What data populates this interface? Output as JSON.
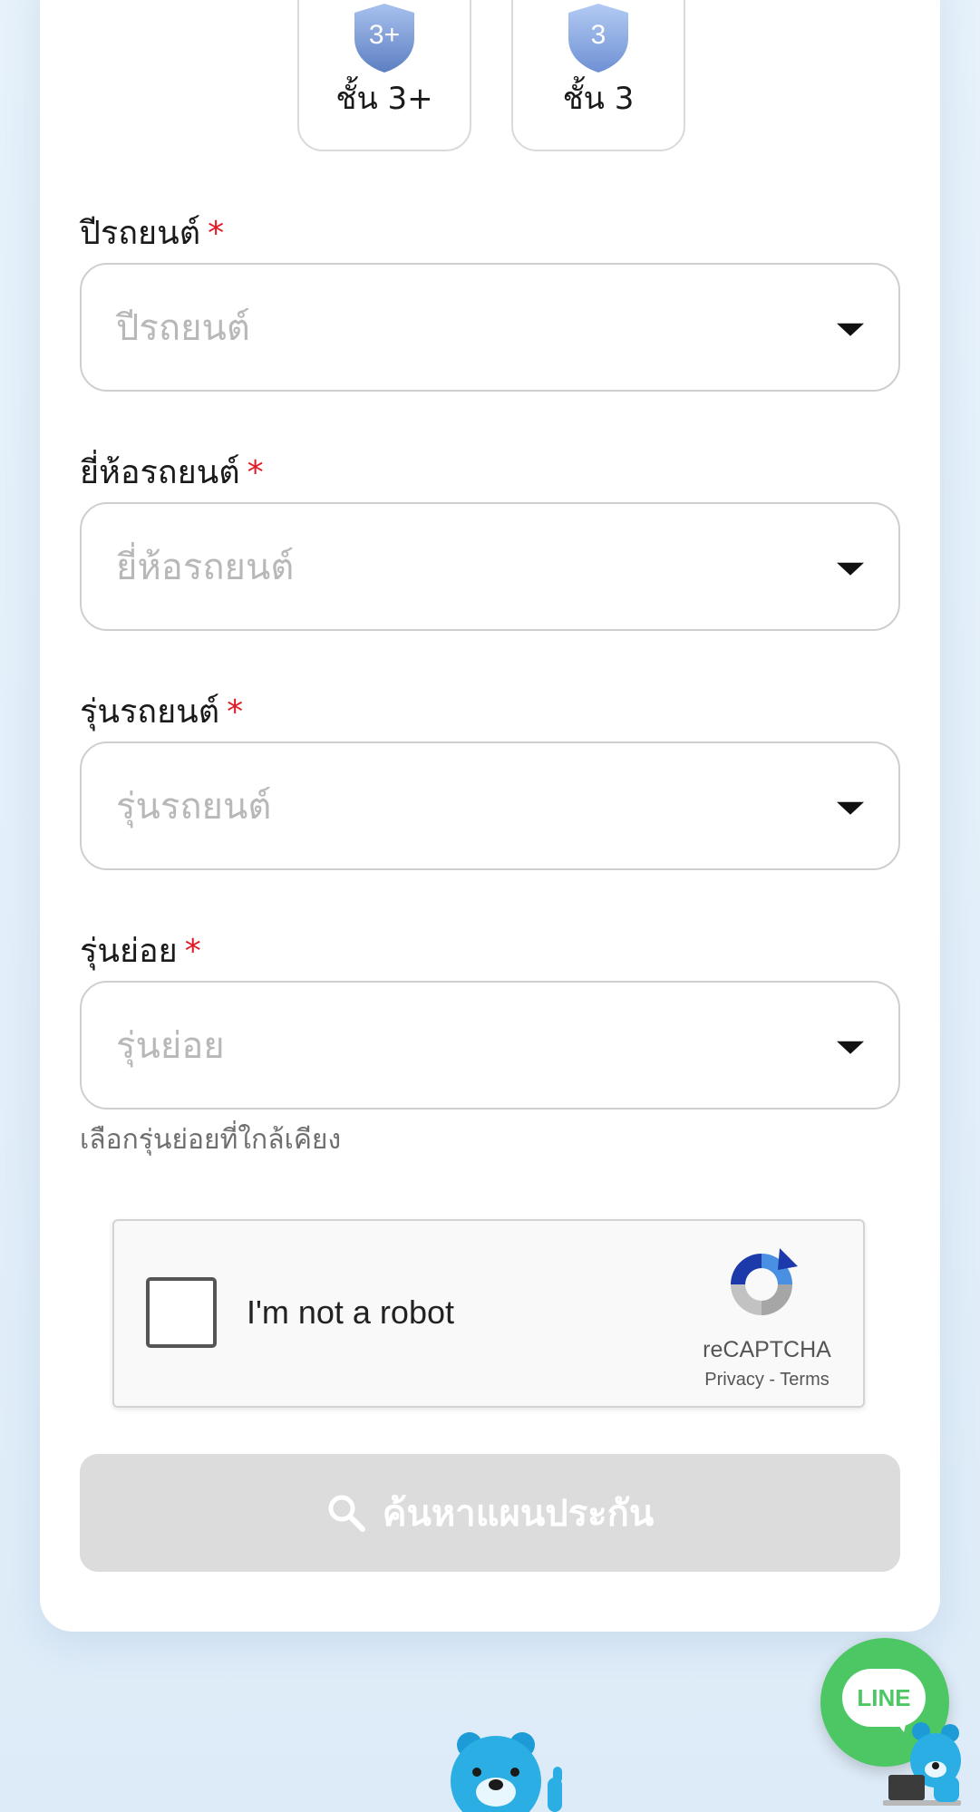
{
  "coverage_options": [
    {
      "badge": "3+",
      "label": "ชั้น 3+"
    },
    {
      "badge": "3",
      "label": "ชั้น 3"
    }
  ],
  "form": {
    "required_mark": "*",
    "car_year": {
      "label": "ปีรถยนต์",
      "placeholder": "ปีรถยนต์"
    },
    "car_brand": {
      "label": "ยี่ห้อรถยนต์",
      "placeholder": "ยี่ห้อรถยนต์"
    },
    "car_model": {
      "label": "รุ่นรถยนต์",
      "placeholder": "รุ่นรถยนต์"
    },
    "car_submodel": {
      "label": "รุ่นย่อย",
      "placeholder": "รุ่นย่อย",
      "hint": "เลือกรุ่นย่อยที่ใกล้เคียง"
    }
  },
  "recaptcha": {
    "text": "I'm not a robot",
    "brand": "reCAPTCHA",
    "privacy": "Privacy",
    "separator": "-",
    "terms": "Terms"
  },
  "search_button": {
    "label": "ค้นหาแผนประกัน",
    "icon": "search-icon",
    "state": "disabled"
  },
  "line_chat": {
    "label": "LINE",
    "color": "#4cc764"
  },
  "colors": {
    "required": "#e01b24",
    "button_disabled": "#dcdcdc",
    "shield": "#7f9fd8"
  }
}
